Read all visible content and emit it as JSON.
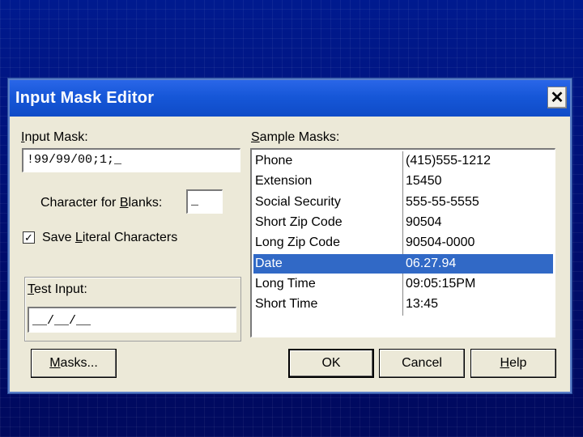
{
  "window": {
    "title": "Input Mask Editor",
    "close_glyph": "✕"
  },
  "input_mask": {
    "label_prefix": "",
    "label_hotkey": "I",
    "label_rest": "nput Mask:",
    "value": "!99/99/00;1;_"
  },
  "blanks": {
    "label_prefix": "Character for ",
    "label_hotkey": "B",
    "label_rest": "lanks:",
    "value": "_"
  },
  "save_literal": {
    "checked_glyph": "✓",
    "label_prefix": "Save ",
    "label_hotkey": "L",
    "label_rest": "iteral Characters"
  },
  "test_input": {
    "label_prefix": "",
    "label_hotkey": "T",
    "label_rest": "est Input:",
    "value": "__/__/__"
  },
  "sample_masks": {
    "label_prefix": "",
    "label_hotkey": "S",
    "label_rest": "ample Masks:",
    "rows": [
      {
        "name": "Phone",
        "example": "(415)555-1212",
        "selected": false
      },
      {
        "name": "Extension",
        "example": "15450",
        "selected": false
      },
      {
        "name": "Social Security",
        "example": "555-55-5555",
        "selected": false
      },
      {
        "name": "Short Zip Code",
        "example": "90504",
        "selected": false
      },
      {
        "name": "Long Zip Code",
        "example": "90504-0000",
        "selected": false
      },
      {
        "name": "Date",
        "example": "06.27.94",
        "selected": true
      },
      {
        "name": "Long Time",
        "example": "09:05:15PM",
        "selected": false
      },
      {
        "name": "Short Time",
        "example": "13:45",
        "selected": false
      }
    ]
  },
  "buttons": {
    "masks": {
      "prefix": "",
      "hotkey": "M",
      "rest": "asks..."
    },
    "ok": "OK",
    "cancel": "Cancel",
    "help": {
      "prefix": "",
      "hotkey": "H",
      "rest": "elp"
    }
  },
  "colors": {
    "selection": "#3169c6",
    "titlebar": "#1657d8",
    "dialog_bg": "#ece9d8"
  }
}
